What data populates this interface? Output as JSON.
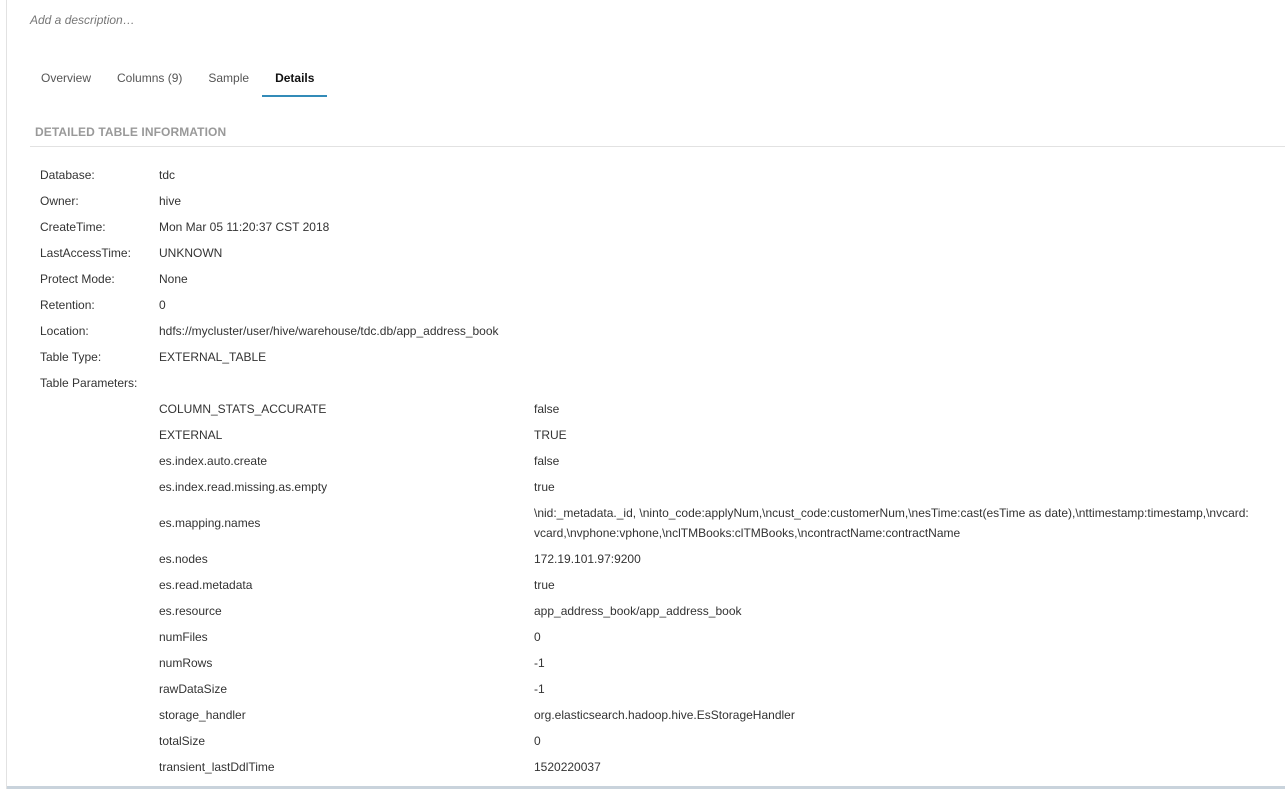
{
  "description_placeholder": "Add a description…",
  "tabs": [
    {
      "label": "Overview"
    },
    {
      "label": "Columns (9)"
    },
    {
      "label": "Sample"
    },
    {
      "label": "Details"
    }
  ],
  "section_title": "DETAILED TABLE INFORMATION",
  "info": [
    {
      "label": "Database:",
      "value": "tdc"
    },
    {
      "label": "Owner:",
      "value": "hive"
    },
    {
      "label": "CreateTime:",
      "value": "Mon Mar 05 11:20:37 CST 2018"
    },
    {
      "label": "LastAccessTime:",
      "value": "UNKNOWN"
    },
    {
      "label": "Protect Mode:",
      "value": "None"
    },
    {
      "label": "Retention:",
      "value": "0"
    },
    {
      "label": "Location:",
      "value": "hdfs://mycluster/user/hive/warehouse/tdc.db/app_address_book"
    },
    {
      "label": "Table Type:",
      "value": "EXTERNAL_TABLE"
    },
    {
      "label": "Table Parameters:",
      "value": ""
    }
  ],
  "parameters": [
    {
      "key": "COLUMN_STATS_ACCURATE",
      "value": "false"
    },
    {
      "key": "EXTERNAL",
      "value": "TRUE"
    },
    {
      "key": "es.index.auto.create",
      "value": "false"
    },
    {
      "key": "es.index.read.missing.as.empty",
      "value": "true"
    },
    {
      "key": "es.mapping.names",
      "value": "\\nid:_metadata._id, \\ninto_code:applyNum,\\ncust_code:customerNum,\\nesTime:cast(esTime as date),\\nttimestamp:timestamp,\\nvcard:vcard,\\nvphone:vphone,\\nclTMBooks:clTMBooks,\\ncontractName:contractName"
    },
    {
      "key": "es.nodes",
      "value": "172.19.101.97:9200"
    },
    {
      "key": "es.read.metadata",
      "value": "true"
    },
    {
      "key": "es.resource",
      "value": "app_address_book/app_address_book"
    },
    {
      "key": "numFiles",
      "value": "0"
    },
    {
      "key": "numRows",
      "value": "-1"
    },
    {
      "key": "rawDataSize",
      "value": "-1"
    },
    {
      "key": "storage_handler",
      "value": "org.elasticsearch.hadoop.hive.EsStorageHandler"
    },
    {
      "key": "totalSize",
      "value": "0"
    },
    {
      "key": "transient_lastDdlTime",
      "value": "1520220037"
    }
  ]
}
